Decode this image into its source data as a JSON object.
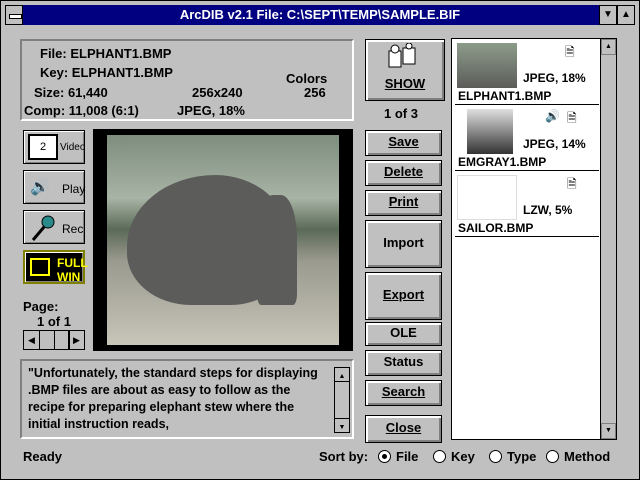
{
  "window": {
    "title": "ArcDIB v2.1 File: C:\\SEPT\\TEMP\\SAMPLE.BIF"
  },
  "info": {
    "file": "File: ELPHANT1.BMP",
    "key": "Key: ELPHANT1.BMP",
    "size": "Size: 61,440",
    "dims": "256x240",
    "colors_label": "Colors",
    "colors_value": "256",
    "comp": "Comp: 11,008 (6:1)",
    "compression": "JPEG, 18%"
  },
  "buttons": {
    "show": "SHOW",
    "counter": "1 of 3",
    "save": "Save",
    "delete": "Delete",
    "print": "Print",
    "import": "Import",
    "export": "Export",
    "ole": "OLE",
    "status": "Status",
    "search": "Search",
    "close": "Close"
  },
  "tools": {
    "video": "Video",
    "play": "Play",
    "rec": "Rec",
    "full": "FULL",
    "win": "WIN"
  },
  "page": {
    "label": "Page:",
    "value": "1 of 1"
  },
  "list": [
    {
      "name": "ELPHANT1.BMP",
      "comp": "JPEG, 18%"
    },
    {
      "name": "EMGRAY1.BMP",
      "comp": "JPEG, 14%"
    },
    {
      "name": "SAILOR.BMP",
      "comp": "LZW, 5%"
    }
  ],
  "description": "\"Unfortunately, the standard steps for displaying .BMP files are about as easy to follow as the recipe for preparing elephant stew where the initial instruction reads,",
  "statusbar": {
    "text": "Ready",
    "sort_label": "Sort by:",
    "options": [
      "File",
      "Key",
      "Type",
      "Method"
    ],
    "selected": "File"
  }
}
